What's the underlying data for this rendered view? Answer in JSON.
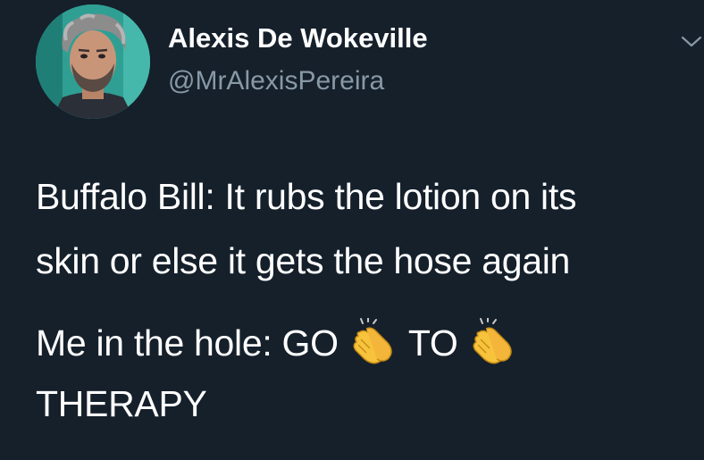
{
  "author": {
    "display_name": "Alexis De Wokeville",
    "handle": "@MrAlexisPereira"
  },
  "icons": {
    "avatar": "profile-photo",
    "menu": "chevron-down-icon",
    "emoji": "clapping-hands-emoji"
  },
  "tweet": {
    "line1": "Buffalo Bill: It rubs the lotion on its",
    "line2": "skin or else it gets the hose again",
    "line3_start": "Me in the hole: GO",
    "line3_middle": "TO",
    "line4": "THERAPY"
  },
  "colors": {
    "background": "#15202b",
    "text": "#ffffff",
    "secondary": "#8899a6"
  }
}
